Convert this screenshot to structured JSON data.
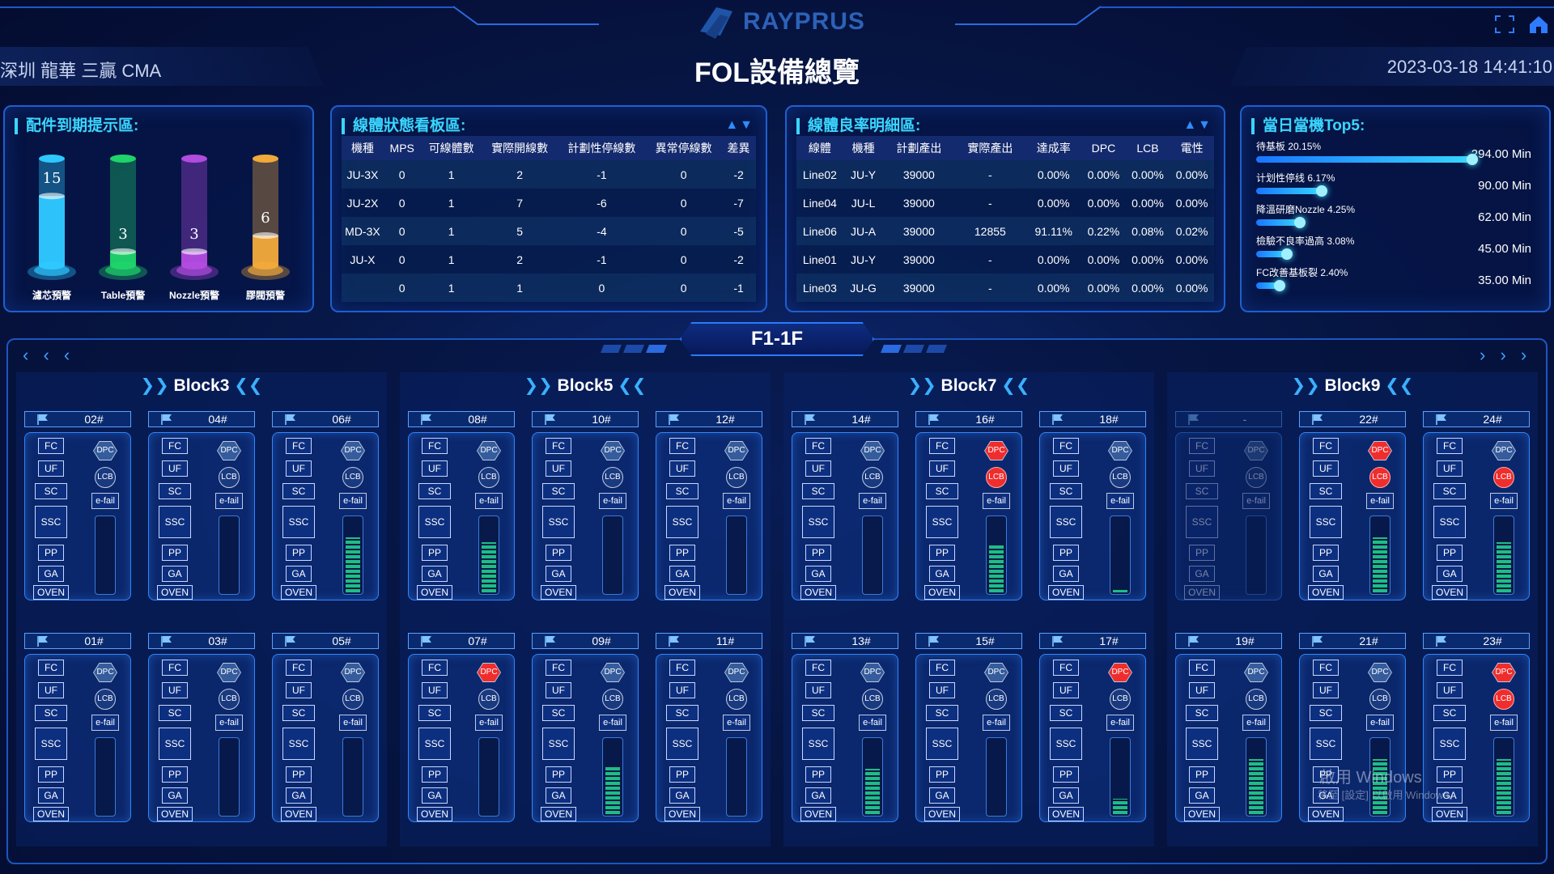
{
  "header": {
    "location": "深圳 龍華 三贏 CMA",
    "title": "FOL設備總覽",
    "datetime": "2023-03-18 14:41:10",
    "logo": "RAYPRUS",
    "icons": [
      "fullscreen-icon",
      "home-icon"
    ]
  },
  "parts": {
    "title": "配件到期提示區:",
    "items": [
      {
        "label": "濾芯預警",
        "value": "15",
        "color": "#2ec8ff",
        "fill": 0.65
      },
      {
        "label": "Table預警",
        "value": "3",
        "color": "#1fd36b",
        "fill": 0.13
      },
      {
        "label": "Nozzle預警",
        "value": "3",
        "color": "#b24be0",
        "fill": 0.13
      },
      {
        "label": "膠閥預警",
        "value": "6",
        "color": "#f0a93a",
        "fill": 0.28
      }
    ]
  },
  "status": {
    "title": "線體狀態看板區:",
    "headers": [
      "機種",
      "MPS",
      "可線體數",
      "實際開線數",
      "計劃性停線數",
      "異常停線數",
      "差異"
    ],
    "rows": [
      [
        "JU-3X",
        "0",
        "1",
        "2",
        "-1",
        "0",
        "-2"
      ],
      [
        "JU-2X",
        "0",
        "1",
        "7",
        "-6",
        "0",
        "-7"
      ],
      [
        "MD-3X",
        "0",
        "1",
        "5",
        "-4",
        "0",
        "-5"
      ],
      [
        "JU-X",
        "0",
        "1",
        "2",
        "-1",
        "0",
        "-2"
      ],
      [
        "",
        "0",
        "1",
        "1",
        "0",
        "0",
        "-1"
      ]
    ]
  },
  "yield": {
    "title": "線體良率明細區:",
    "headers": [
      "線體",
      "機種",
      "計劃產出",
      "實際產出",
      "達成率",
      "DPC",
      "LCB",
      "電性"
    ],
    "rows": [
      [
        "Line02",
        "JU-Y",
        "39000",
        "-",
        "0.00%",
        "0.00%",
        "0.00%",
        "0.00%"
      ],
      [
        "Line04",
        "JU-L",
        "39000",
        "-",
        "0.00%",
        "0.00%",
        "0.00%",
        "0.00%"
      ],
      [
        "Line06",
        "JU-A",
        "39000",
        "12855",
        "91.11%",
        "0.22%",
        "0.08%",
        "0.02%"
      ],
      [
        "Line01",
        "JU-Y",
        "39000",
        "-",
        "0.00%",
        "0.00%",
        "0.00%",
        "0.00%"
      ],
      [
        "Line03",
        "JU-G",
        "39000",
        "-",
        "0.00%",
        "0.00%",
        "0.00%",
        "0.00%"
      ]
    ]
  },
  "top5": {
    "title": "當日當機Top5:",
    "items": [
      {
        "label": "待基板 20.15%",
        "value": "294.00 Min",
        "pct": 1.0
      },
      {
        "label": "计划性停线 6.17%",
        "value": "90.00 Min",
        "pct": 0.31
      },
      {
        "label": "降溫研磨Nozzle 4.25%",
        "value": "62.00 Min",
        "pct": 0.21
      },
      {
        "label": "檢驗不良率過高 3.08%",
        "value": "45.00 Min",
        "pct": 0.15
      },
      {
        "label": "FC改善基板裂 2.40%",
        "value": "35.00 Min",
        "pct": 0.12
      }
    ]
  },
  "floor": {
    "label": "F1-1F",
    "nav_left": "‹ ‹ ‹",
    "nav_right": "› › ›"
  },
  "stations": {
    "fc": "FC",
    "uf": "UF",
    "sc": "SC",
    "ssc": "SSC",
    "pp": "PP",
    "ga": "GA",
    "oven": "OVEN",
    "dpc": "DPC",
    "lcb": "LCB",
    "efail": "e-fail"
  },
  "blocks": [
    {
      "name": "Block3",
      "machines": [
        {
          "num": "02#",
          "dpc": false,
          "lcb": false,
          "level": 0,
          "disabled": false
        },
        {
          "num": "04#",
          "dpc": false,
          "lcb": false,
          "level": 0,
          "disabled": false
        },
        {
          "num": "06#",
          "dpc": false,
          "lcb": false,
          "level": 0.72,
          "disabled": false
        },
        {
          "num": "01#",
          "dpc": false,
          "lcb": false,
          "level": 0,
          "disabled": false
        },
        {
          "num": "03#",
          "dpc": false,
          "lcb": false,
          "level": 0,
          "disabled": false
        },
        {
          "num": "05#",
          "dpc": false,
          "lcb": false,
          "level": 0,
          "disabled": false
        }
      ]
    },
    {
      "name": "Block5",
      "machines": [
        {
          "num": "08#",
          "dpc": false,
          "lcb": false,
          "level": 0.66,
          "disabled": false
        },
        {
          "num": "10#",
          "dpc": false,
          "lcb": false,
          "level": 0,
          "disabled": false
        },
        {
          "num": "12#",
          "dpc": false,
          "lcb": false,
          "level": 0,
          "disabled": false
        },
        {
          "num": "07#",
          "dpc": true,
          "lcb": false,
          "level": 0,
          "disabled": false
        },
        {
          "num": "09#",
          "dpc": false,
          "lcb": false,
          "level": 0.62,
          "disabled": false
        },
        {
          "num": "11#",
          "dpc": false,
          "lcb": false,
          "level": 0,
          "disabled": false
        }
      ]
    },
    {
      "name": "Block7",
      "machines": [
        {
          "num": "14#",
          "dpc": false,
          "lcb": false,
          "level": 0,
          "disabled": false
        },
        {
          "num": "16#",
          "dpc": true,
          "lcb": true,
          "level": 0.62,
          "disabled": false
        },
        {
          "num": "18#",
          "dpc": false,
          "lcb": false,
          "level": 0.03,
          "disabled": false
        },
        {
          "num": "13#",
          "dpc": false,
          "lcb": false,
          "level": 0.6,
          "disabled": false
        },
        {
          "num": "15#",
          "dpc": false,
          "lcb": false,
          "level": 0,
          "disabled": false
        },
        {
          "num": "17#",
          "dpc": true,
          "lcb": false,
          "level": 0.2,
          "disabled": false
        }
      ]
    },
    {
      "name": "Block9",
      "machines": [
        {
          "num": "-",
          "dpc": false,
          "lcb": false,
          "level": 0,
          "disabled": true
        },
        {
          "num": "22#",
          "dpc": true,
          "lcb": true,
          "level": 0.72,
          "disabled": false
        },
        {
          "num": "24#",
          "dpc": false,
          "lcb": true,
          "level": 0.66,
          "disabled": false
        },
        {
          "num": "19#",
          "dpc": false,
          "lcb": false,
          "level": 0.72,
          "disabled": false
        },
        {
          "num": "21#",
          "dpc": false,
          "lcb": false,
          "level": 0.72,
          "disabled": false
        },
        {
          "num": "23#",
          "dpc": true,
          "lcb": true,
          "level": 0.72,
          "disabled": false
        }
      ]
    }
  ],
  "watermark": {
    "line1": "啟用 Windows",
    "line2": "移至 [設定] 以啟用 Windows。"
  }
}
